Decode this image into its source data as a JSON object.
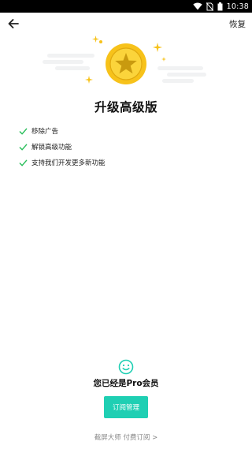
{
  "status_bar": {
    "time": "10:38",
    "icons": [
      "wifi-icon",
      "no-sim-icon",
      "battery-icon"
    ]
  },
  "header": {
    "back_icon": "arrow-left-icon",
    "restore_label": "恢复"
  },
  "hero": {
    "coin_icon": "gold-star-coin-icon",
    "title": "升级高级版"
  },
  "features": [
    {
      "label": "移除广告",
      "icon": "check-icon"
    },
    {
      "label": "解锁高级功能",
      "icon": "check-icon"
    },
    {
      "label": "支持我们开发更多新功能",
      "icon": "check-icon"
    }
  ],
  "membership": {
    "icon": "smile-icon",
    "status_text": "您已经是Pro会员",
    "manage_label": "订阅管理"
  },
  "footer": {
    "link_text": "截屏大师 付费订阅 >"
  },
  "colors": {
    "accent": "#1fcfb3",
    "check": "#2bbf5c",
    "coin": "#f7c21a",
    "star": "#c99a0f"
  }
}
